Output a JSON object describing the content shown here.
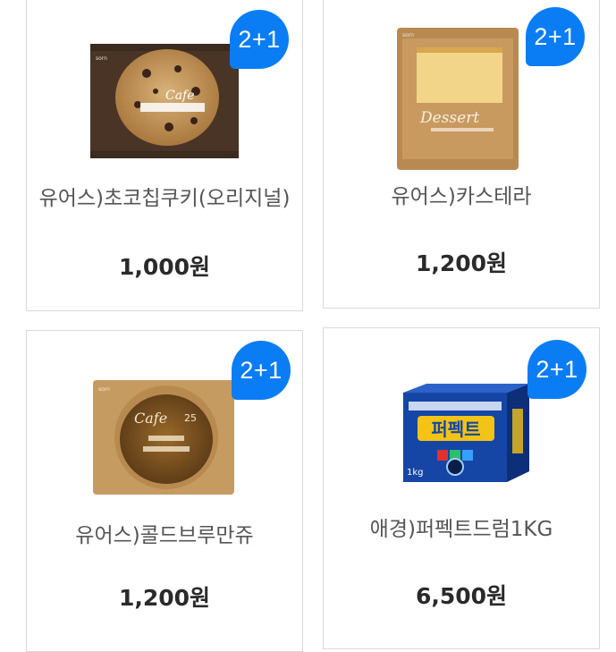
{
  "products": [
    {
      "name": "유어스)초코칩쿠키(오리지널)",
      "price": "1,000원",
      "badge": "2+1",
      "image_icon": "cookie-package-image"
    },
    {
      "name": "유어스)카스테라",
      "price": "1,200원",
      "badge": "2+1",
      "image_icon": "castella-package-image"
    },
    {
      "name": "유어스)콜드브루만쥬",
      "price": "1,200원",
      "badge": "2+1",
      "image_icon": "cold-brew-manju-package-image"
    },
    {
      "name": "애경)퍼펙트드럼1KG",
      "price": "6,500원",
      "badge": "2+1",
      "image_icon": "detergent-box-image"
    }
  ],
  "colors": {
    "badge": "#0a7df5",
    "card_border": "#d9d9d9",
    "name_text": "#555555",
    "price_text": "#2a2a2a"
  }
}
